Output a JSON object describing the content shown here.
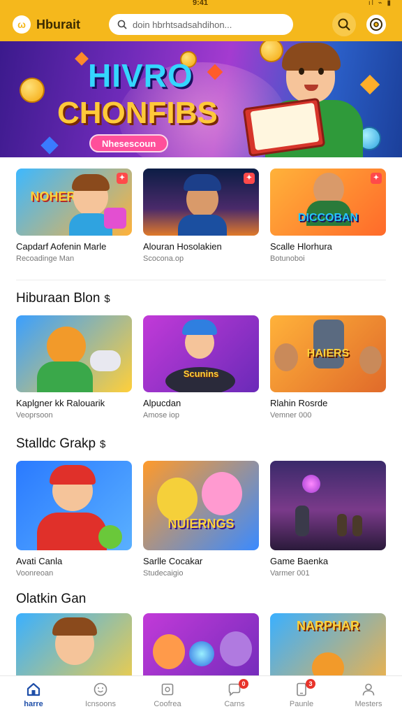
{
  "status": {
    "time": "9:41",
    "signal": "ıl ⌁ ▮"
  },
  "header": {
    "logo_mark": "ω",
    "brand": "Hburait",
    "search_placeholder": "doin hbrhtsadsahdihon..."
  },
  "banner": {
    "title_line1": "HIVRO",
    "title_line2": "CHONFIBS",
    "cta": "Nhesescoun"
  },
  "row1": [
    {
      "thumb_text": "NOHER",
      "title": "Capdarf Aofenin Marle",
      "sub": "Recoadinge Man"
    },
    {
      "thumb_text": "",
      "title": "Alouran Hosolakien",
      "sub": "Scocona.op"
    },
    {
      "thumb_text": "DICCOBAN",
      "title": "Scalle Hlorhura",
      "sub": "Botunoboi"
    }
  ],
  "section2": {
    "title": "Hiburaan Blon",
    "icon": "$"
  },
  "row2": [
    {
      "thumb_text": "",
      "title": "Kaplgner kk Ralouarik",
      "sub": "Veoprsoon"
    },
    {
      "thumb_text": "Scunins",
      "title": "Alpucdan",
      "sub": "Amose iop"
    },
    {
      "thumb_text": "HAIERS",
      "title": "Rlahin Rosrde",
      "sub": "Vemner 000"
    }
  ],
  "section3": {
    "title": "Stalldc Grakp",
    "icon": "$"
  },
  "row3": [
    {
      "thumb_text": "",
      "title": "Avati Canla",
      "sub": "Voonreoan"
    },
    {
      "thumb_text": "NUIERNGS",
      "title": "Sarlle Cocakar",
      "sub": "Studecaigio"
    },
    {
      "thumb_text": "",
      "title": "Game Baenka",
      "sub": "Varmer 001"
    }
  ],
  "section4": {
    "title": "Olatkin Gan"
  },
  "row4": [
    {
      "thumb_text": ""
    },
    {
      "thumb_text": ""
    },
    {
      "thumb_text": "NARPHAR"
    }
  ],
  "nav": [
    {
      "label": "harre",
      "icon": "home-icon",
      "badge": ""
    },
    {
      "label": "Icnsoons",
      "icon": "smiley-icon",
      "badge": ""
    },
    {
      "label": "Coofrea",
      "icon": "frame-icon",
      "badge": ""
    },
    {
      "label": "Carns",
      "icon": "chat-icon",
      "badge": "0"
    },
    {
      "label": "Paunle",
      "icon": "tablet-icon",
      "badge": "3"
    },
    {
      "label": "Mesters",
      "icon": "person-icon",
      "badge": ""
    }
  ],
  "colors": {
    "accent": "#f5b81c",
    "active_nav": "#1e4ea8",
    "badge": "#e8332a"
  }
}
